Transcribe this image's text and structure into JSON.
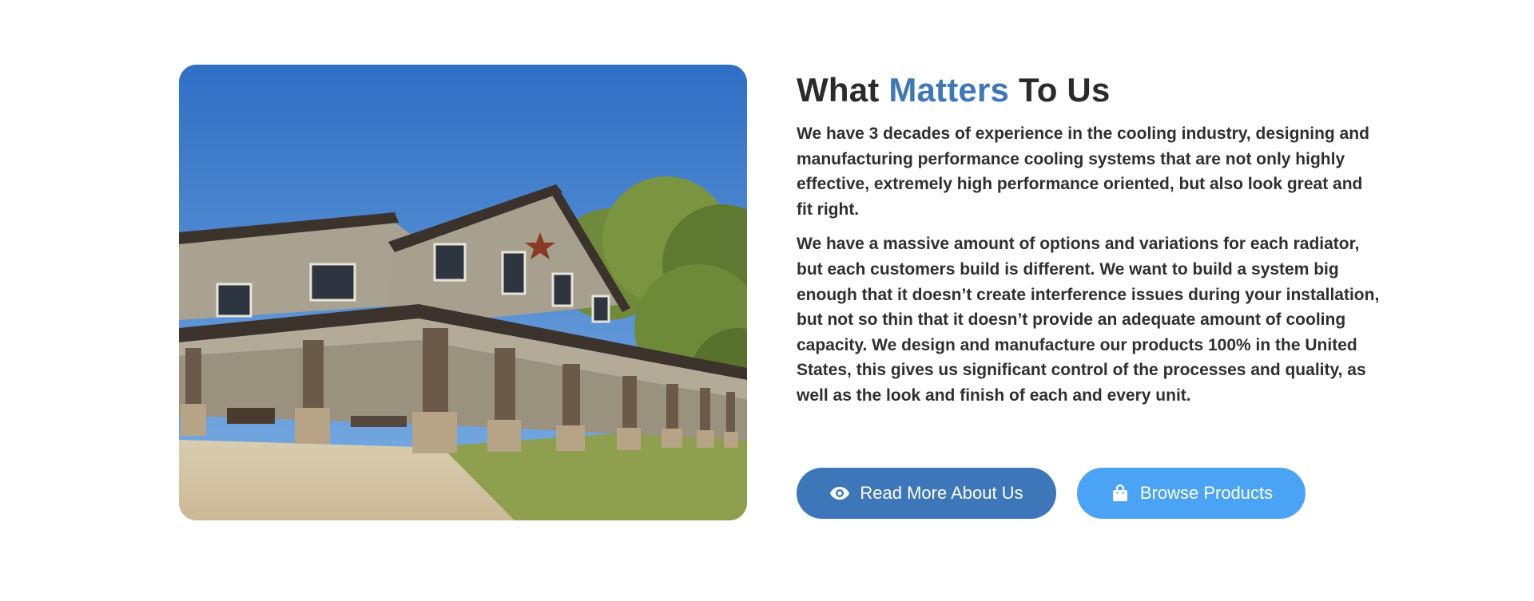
{
  "heading": {
    "part1": "What ",
    "accent": "Matters",
    "part2": " To Us"
  },
  "paragraphs": [
    "We have 3 decades of experience in the cooling industry, designing and manufacturing performance cooling systems that are not only highly effective, extremely high performance oriented, but also look great and fit right.",
    "We have a massive amount of options and variations for each radiator, but each customers build is different. We want to build a system big enough that it doesn’t create interference issues during your installation, but not so thin that it doesn’t provide an adequate amount of cooling capacity. We design and manufacture our products 100% in the United States, this gives us significant control of the processes and quality, as well as the look and finish of each and every unit."
  ],
  "buttons": {
    "read_more": {
      "label": "Read More About Us",
      "icon": "eye-icon"
    },
    "browse": {
      "label": "Browse Products",
      "icon": "shopping-bag-icon"
    }
  },
  "colors": {
    "accent": "#3f78b6",
    "primary_button": "#3d77b9",
    "secondary_button": "#4aa3f5",
    "text": "#2b2b2b"
  }
}
